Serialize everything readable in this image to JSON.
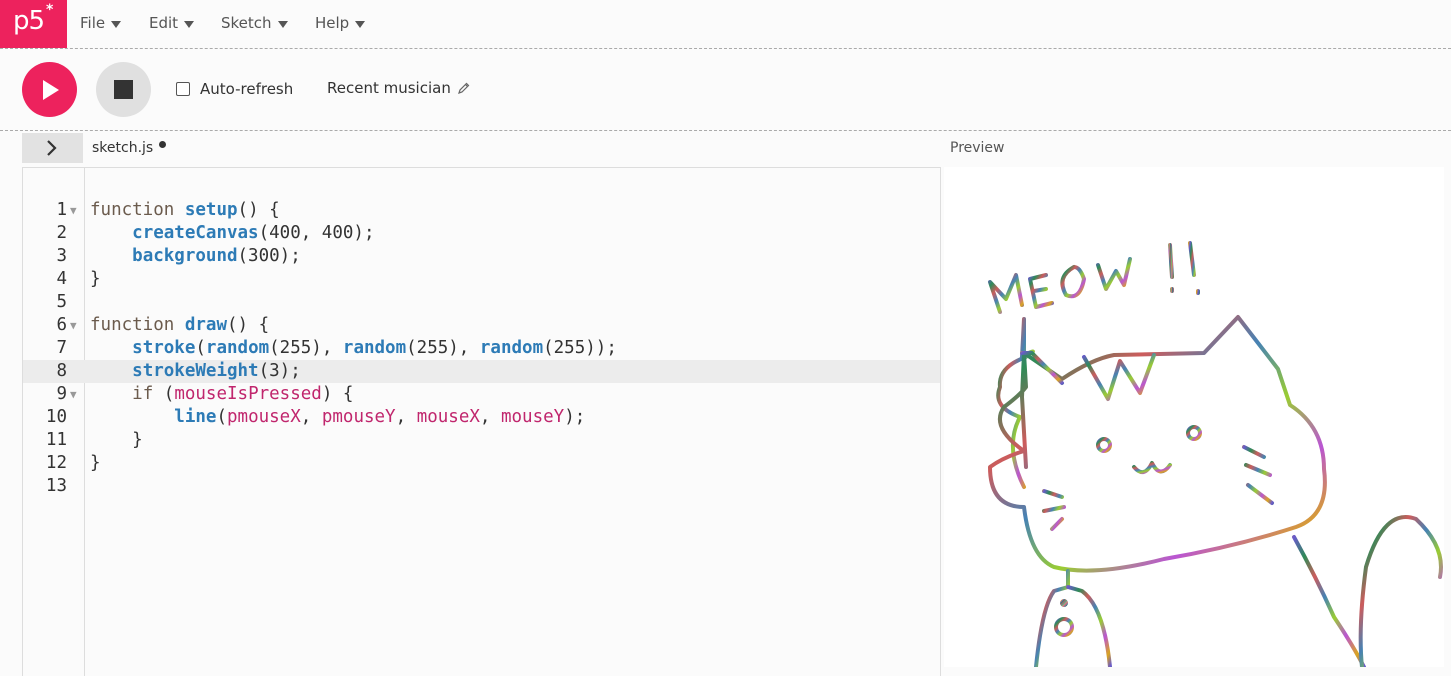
{
  "app": {
    "logo": "p5",
    "logo_star": "*"
  },
  "menu": {
    "file": "File",
    "edit": "Edit",
    "sketch": "Sketch",
    "help": "Help"
  },
  "toolbar": {
    "play_icon": "play-icon",
    "stop_icon": "stop-icon",
    "auto_refresh_label": "Auto-refresh",
    "auto_refresh_checked": false,
    "sketch_name": "Recent musician",
    "edit_icon": "pencil-icon"
  },
  "editor": {
    "file_name": "sketch.js",
    "unsaved": true,
    "active_line": 8,
    "lines": [
      {
        "n": "1",
        "text": "function setup() {",
        "fold": true
      },
      {
        "n": "2",
        "text": "    createCanvas(400, 400);"
      },
      {
        "n": "3",
        "text": "    background(300);"
      },
      {
        "n": "4",
        "text": "}"
      },
      {
        "n": "5",
        "text": ""
      },
      {
        "n": "6",
        "text": "function draw() {",
        "fold": true
      },
      {
        "n": "7",
        "text": "    stroke(random(255), random(255), random(255));"
      },
      {
        "n": "8",
        "text": "    strokeWeight(3);"
      },
      {
        "n": "9",
        "text": "    if (mouseIsPressed) {",
        "fold": true
      },
      {
        "n": "10",
        "text": "        line(pmouseX, pmouseY, mouseX, mouseY);"
      },
      {
        "n": "11",
        "text": "    }"
      },
      {
        "n": "12",
        "text": "}"
      },
      {
        "n": "13",
        "text": ""
      }
    ]
  },
  "preview": {
    "label": "Preview",
    "drawing_text": "MEOW !!"
  },
  "colors": {
    "accent": "#ed225d",
    "function": "#2d7bb6",
    "variable": "#c0266d"
  }
}
